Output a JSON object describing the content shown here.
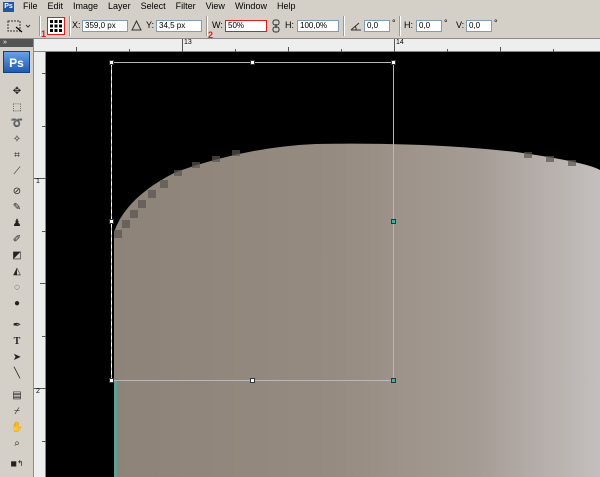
{
  "menu": {
    "logo": "Ps",
    "items": [
      "File",
      "Edit",
      "Image",
      "Layer",
      "Select",
      "Filter",
      "View",
      "Window",
      "Help"
    ]
  },
  "options": {
    "marker1": "1",
    "marker2": "2",
    "x_label": "X:",
    "x_value": "359,0 px",
    "y_label": "Y:",
    "y_value": "34,5 px",
    "w_label": "W:",
    "w_value": "50%",
    "h_label": "H:",
    "h_value": "100,0%",
    "angle_value": "0,0",
    "angle_unit": "°",
    "hskew_label": "H:",
    "hskew_value": "0,0",
    "hskew_unit": "°",
    "vskew_label": "V:",
    "vskew_value": "0,0",
    "vskew_unit": "°"
  },
  "toolbox": {
    "logo": "Ps",
    "grip": "»"
  },
  "rulers": {
    "top": [
      "13",
      "14"
    ],
    "left": [
      "1",
      "2"
    ]
  },
  "colors": {
    "accent_red": "#e21c1c",
    "ps_blue": "#1f56a8",
    "handle_cyan": "#2fb8b0",
    "image_gray": "#9a8f85"
  }
}
